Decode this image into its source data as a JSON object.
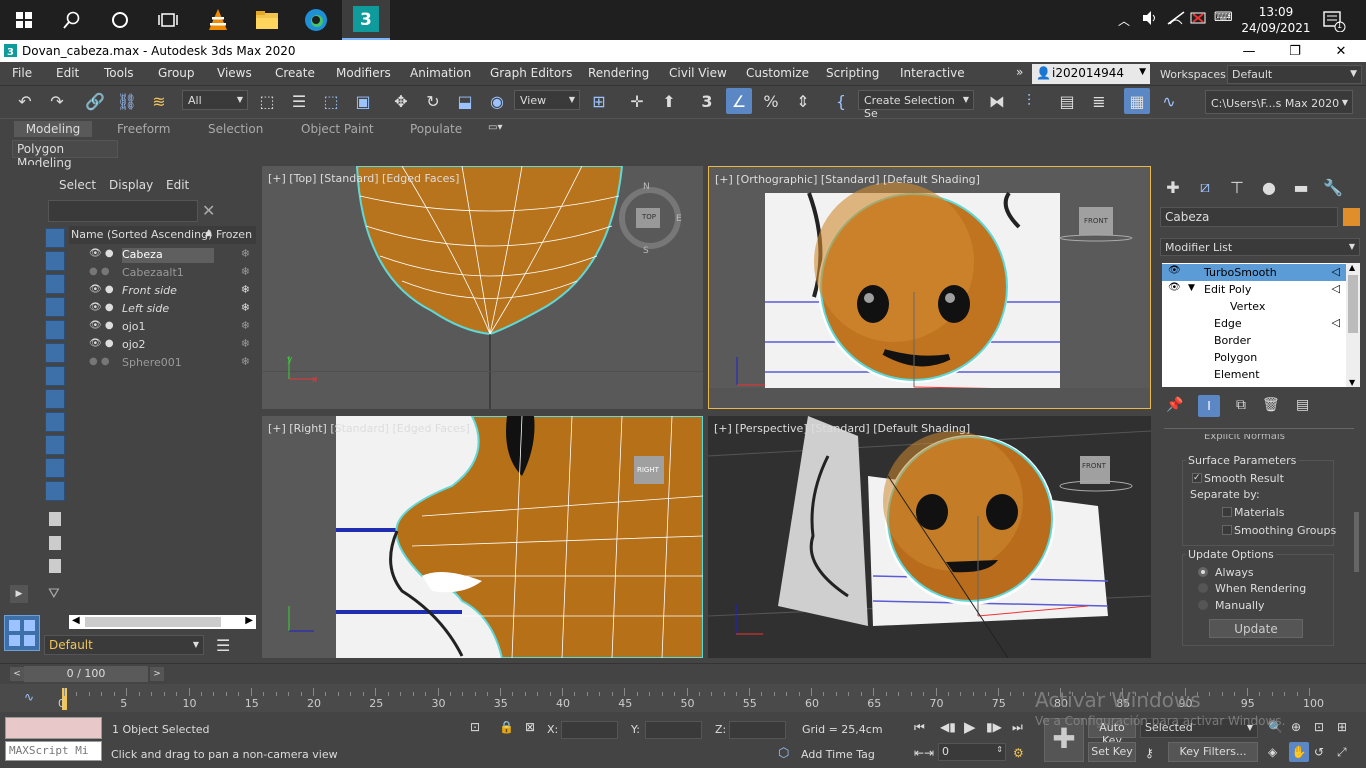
{
  "taskbar": {
    "time": "13:09",
    "date": "24/09/2021",
    "notifications": "1"
  },
  "window": {
    "title": "Dovan_cabeza.max - Autodesk 3ds Max 2020"
  },
  "menu": {
    "items": [
      "File",
      "Edit",
      "Tools",
      "Group",
      "Views",
      "Create",
      "Modifiers",
      "Animation",
      "Graph Editors",
      "Rendering",
      "Civil View",
      "Customize",
      "Scripting",
      "Interactive"
    ],
    "user": "i202014944",
    "workspaces_label": "Workspaces:",
    "workspace": "Default"
  },
  "toolbar": {
    "filter": "All",
    "ref_coord": "View",
    "selection_set": "Create Selection Se",
    "path": "C:\\Users\\F...s Max 2020"
  },
  "ribbon": {
    "tabs": [
      "Modeling",
      "Freeform",
      "Selection",
      "Object Paint",
      "Populate"
    ],
    "panel": "Polygon Modeling"
  },
  "explorer": {
    "tabs": [
      "Select",
      "Display",
      "Edit"
    ],
    "col_name": "Name (Sorted Ascending)",
    "col_frozen": "Frozen",
    "rows": [
      {
        "name": "Cabeza",
        "style": "selected"
      },
      {
        "name": "Cabezaalt1",
        "style": "dim"
      },
      {
        "name": "Front side",
        "style": "italic"
      },
      {
        "name": "Left side",
        "style": "italic"
      },
      {
        "name": "ojo1",
        "style": "normal"
      },
      {
        "name": "ojo2",
        "style": "normal"
      },
      {
        "name": "Sphere001",
        "style": "dim"
      }
    ],
    "layer": "Default"
  },
  "viewports": {
    "top": "[+] [Top] [Standard] [Edged Faces]",
    "ortho": "[+] [Orthographic] [Standard] [Default Shading]",
    "right": "[+] [Right] [Standard] [Edged Faces]",
    "persp": "[+] [Perspective] [Standard] [Default Shading]",
    "cube_top": "TOP",
    "cube_front": "FRONT",
    "cube_right": "RIGHT",
    "compass": [
      "N",
      "E",
      "S"
    ]
  },
  "command_panel": {
    "object_name": "Cabeza",
    "modifier_list": "Modifier List",
    "stack": [
      "TurboSmooth",
      "Edit Poly",
      "Vertex",
      "Edge",
      "Border",
      "Polygon",
      "Element"
    ],
    "cut_label": "Explicit Normals",
    "surface_params": "Surface Parameters",
    "smooth_result": "Smooth Result",
    "separate_by": "Separate by:",
    "materials": "Materials",
    "smoothing_groups": "Smoothing Groups",
    "update_options": "Update Options",
    "always": "Always",
    "when_rendering": "When Rendering",
    "manually": "Manually",
    "update_btn": "Update",
    "accent": "#e08d2c"
  },
  "timeline": {
    "slider": "0 / 100",
    "ticks": [
      "0",
      "5",
      "10",
      "15",
      "20",
      "25",
      "30",
      "35",
      "40",
      "45",
      "50",
      "55",
      "60",
      "65",
      "70",
      "75",
      "80",
      "85",
      "90",
      "95",
      "100"
    ]
  },
  "status": {
    "script": "MAXScript Mi",
    "selected": "1 Object Selected",
    "prompt": "Click and drag to pan a non-camera view",
    "x": "X:",
    "y": "Y:",
    "z": "Z:",
    "grid": "Grid = 25,4cm",
    "add_time_tag": "Add Time Tag",
    "auto_key": "Auto Key",
    "set_key": "Set Key",
    "selected_dd": "Selected",
    "key_filters": "Key Filters...",
    "frame": "0",
    "watermark1": "Activar Windows",
    "watermark2": "Ve a Configuración para activar Windows."
  }
}
